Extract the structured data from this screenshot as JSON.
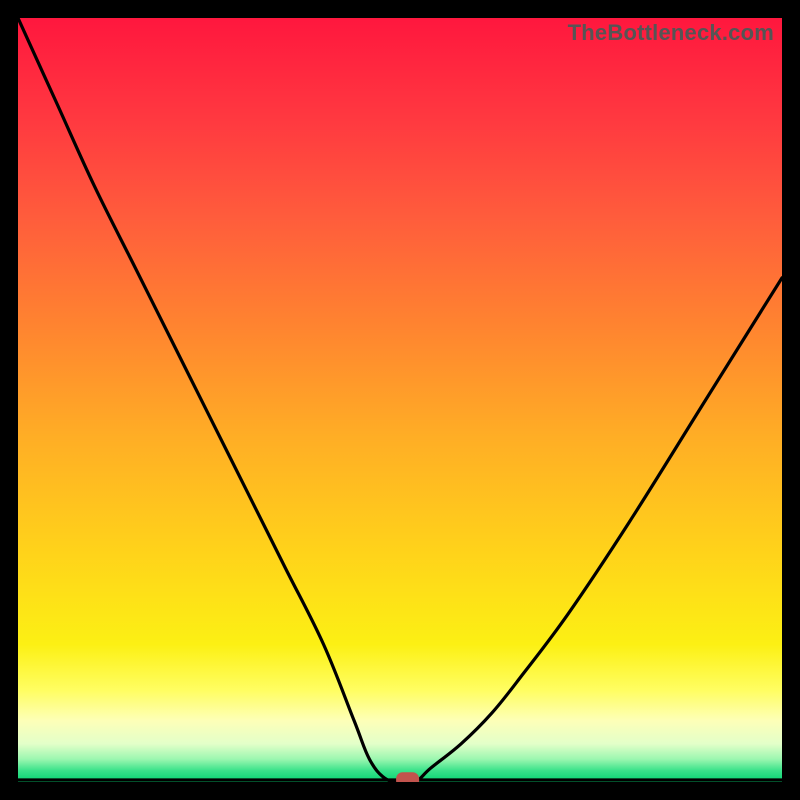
{
  "watermark": "TheBottleneck.com",
  "colors": {
    "black": "#000000",
    "marker": "#c1534d",
    "gradient_stops": [
      {
        "offset": 0.0,
        "color": "#ff173e"
      },
      {
        "offset": 0.13,
        "color": "#ff3840"
      },
      {
        "offset": 0.26,
        "color": "#ff5c3c"
      },
      {
        "offset": 0.4,
        "color": "#ff8330"
      },
      {
        "offset": 0.55,
        "color": "#ffae25"
      },
      {
        "offset": 0.7,
        "color": "#ffd31a"
      },
      {
        "offset": 0.82,
        "color": "#fcf014"
      },
      {
        "offset": 0.88,
        "color": "#fffe62"
      },
      {
        "offset": 0.92,
        "color": "#fdffb8"
      },
      {
        "offset": 0.95,
        "color": "#e3ffc9"
      },
      {
        "offset": 0.97,
        "color": "#9cf7b0"
      },
      {
        "offset": 0.985,
        "color": "#3ae28a"
      },
      {
        "offset": 1.0,
        "color": "#05d371"
      }
    ]
  },
  "chart_data": {
    "type": "line",
    "title": "",
    "xlabel": "",
    "ylabel": "",
    "xlim": [
      0,
      100
    ],
    "ylim": [
      0,
      100
    ],
    "grid": false,
    "series": [
      {
        "name": "bottleneck-curve",
        "x": [
          0,
          5,
          10,
          15,
          20,
          25,
          30,
          35,
          40,
          44,
          46,
          48,
          50,
          52,
          54,
          58,
          62,
          66,
          72,
          80,
          90,
          100
        ],
        "y": [
          100,
          89,
          78,
          68,
          58,
          48,
          38,
          28,
          18,
          8,
          3,
          0.5,
          0,
          0,
          1.8,
          5,
          9,
          14,
          22,
          34,
          50,
          66
        ]
      }
    ],
    "annotations": [
      {
        "name": "optimal-marker",
        "x": 51,
        "y": 0.3,
        "shape": "pill",
        "color": "#c1534d"
      }
    ]
  }
}
